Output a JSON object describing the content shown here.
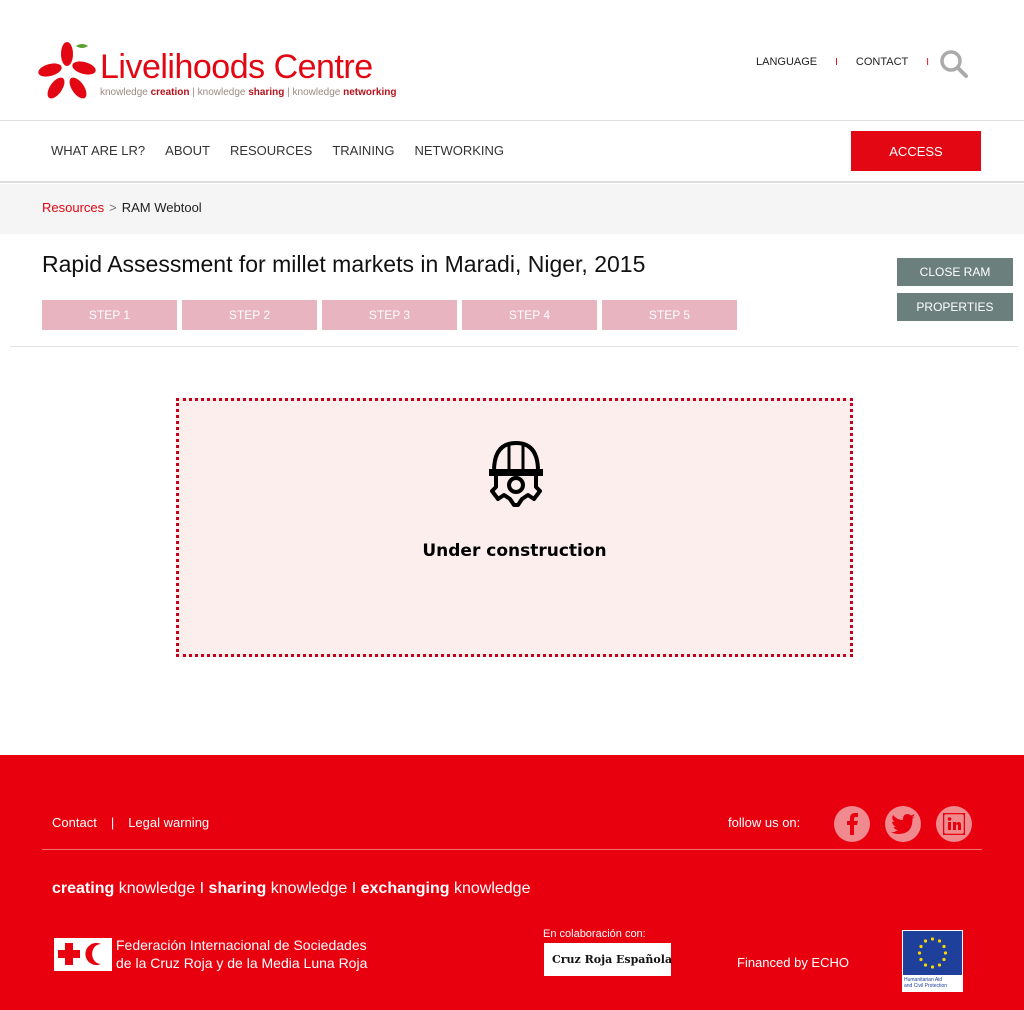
{
  "header": {
    "logo_title_a": "Live",
    "logo_title_b": "lihoods Centre",
    "logo_tagline": {
      "k1": "knowledge ",
      "t1": "creation",
      "sep": " | ",
      "k2": "knowledge ",
      "t2": "sharing",
      "k3": "knowledge ",
      "t3": "networking"
    },
    "language_label": "LANGUAGE",
    "contact_label": "CONTACT",
    "separator": "I"
  },
  "nav": {
    "items": [
      "WHAT ARE LR?",
      "ABOUT",
      "RESOURCES",
      "TRAINING",
      "NETWORKING"
    ],
    "access_label": "ACCESS"
  },
  "breadcrumb": {
    "link": "Resources",
    "sep": ">",
    "current": "RAM Webtool"
  },
  "main": {
    "title": "Rapid Assessment for millet markets in Maradi, Niger, 2015",
    "steps": [
      "STEP 1",
      "STEP 2",
      "STEP 3",
      "STEP 4",
      "STEP 5"
    ],
    "close_ram_label": "CLOSE RAM",
    "properties_label": "PROPERTIES",
    "under_construction": "Under construction"
  },
  "footer": {
    "contact_label": "Contact",
    "sep": "|",
    "legal_label": "Legal warning",
    "follow_label": "follow us on:",
    "tagline": {
      "w1": "creating",
      "k1": " knowledge ",
      "sep": "I",
      "w2": " sharing",
      "k2": " knowledge ",
      "w3": " exchanging",
      "k3": " knowledge"
    },
    "ifrc_line1": "Federación Internacional de Sociedades",
    "ifrc_line2": "de la Cruz Roja y de la Media Luna Roja",
    "colab_label": "En colaboración con:",
    "cre_label": "Cruz Roja Española",
    "financed_label": "Financed by ECHO",
    "eu_line1": "Humanitarian Aid",
    "eu_line2": "and Civil Protection"
  },
  "colors": {
    "brand_red": "#e30613",
    "footer_red": "#e8000f",
    "step_pink": "#e8b4c0",
    "side_button_gray": "#6b7f7d"
  }
}
